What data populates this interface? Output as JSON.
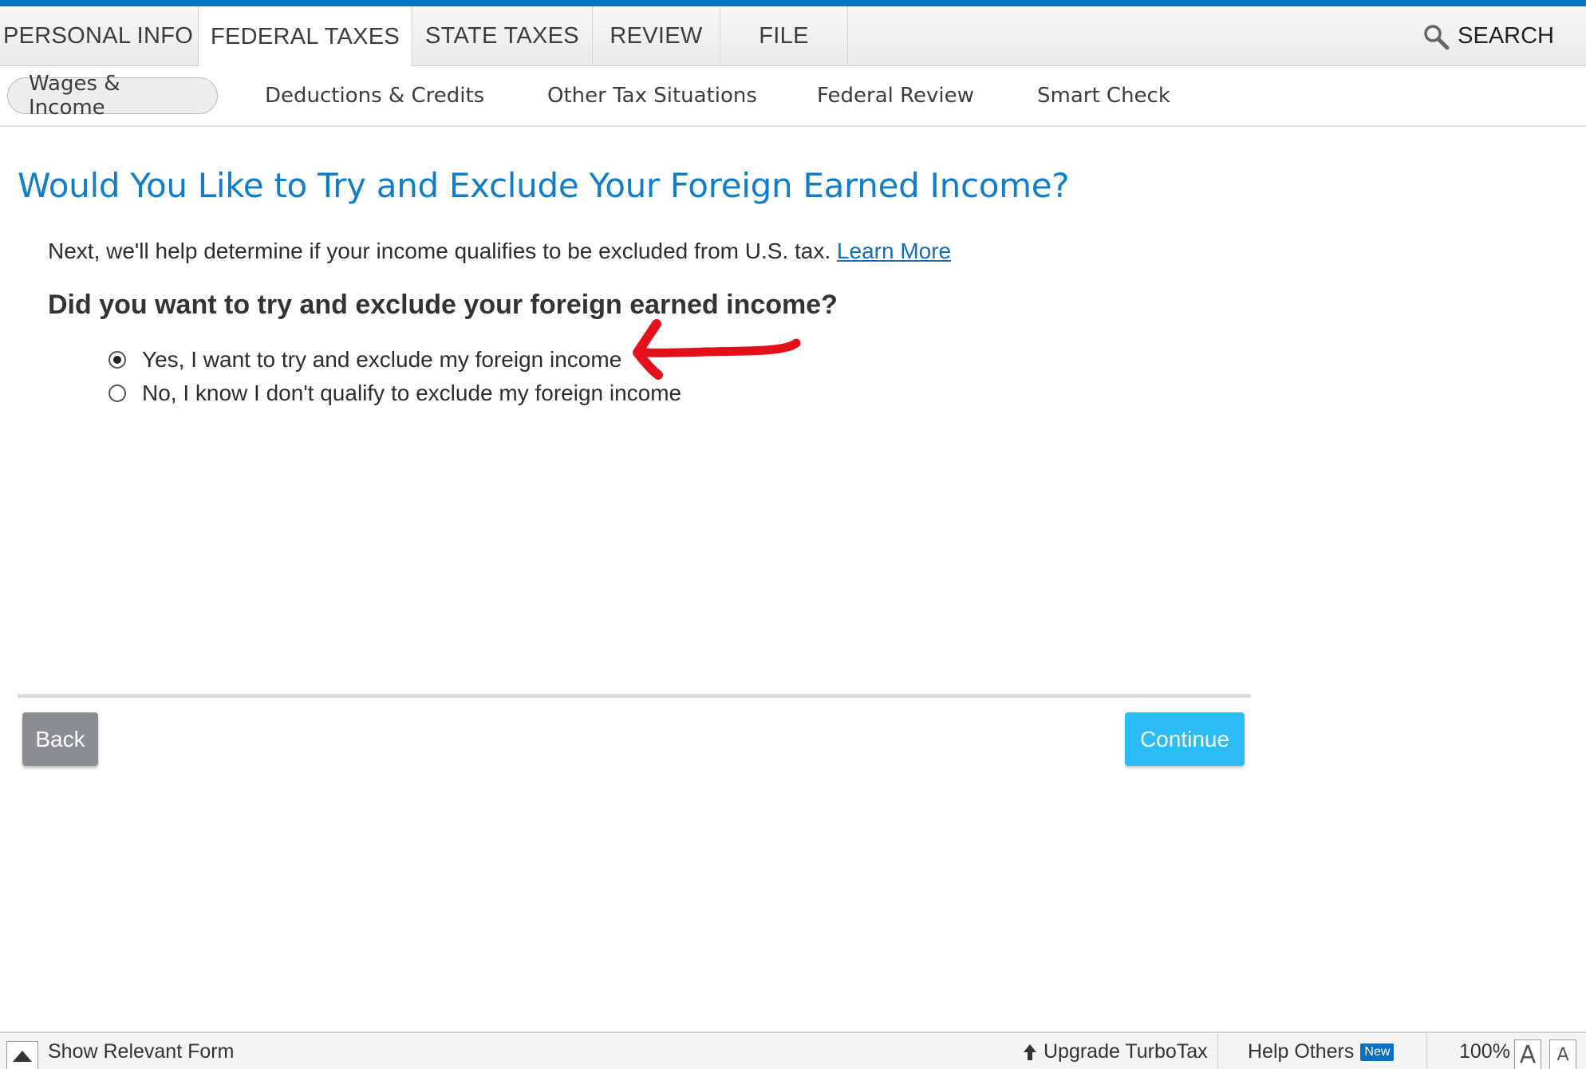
{
  "main_nav": {
    "tabs": [
      {
        "label": "PERSONAL INFO",
        "active": false
      },
      {
        "label": "FEDERAL TAXES",
        "active": true
      },
      {
        "label": "STATE TAXES",
        "active": false
      },
      {
        "label": "REVIEW",
        "active": false
      },
      {
        "label": "FILE",
        "active": false
      }
    ],
    "search_label": "SEARCH"
  },
  "sub_nav": {
    "tabs": [
      {
        "label": "Wages & Income",
        "active": true
      },
      {
        "label": "Deductions & Credits",
        "active": false
      },
      {
        "label": "Other Tax Situations",
        "active": false
      },
      {
        "label": "Federal Review",
        "active": false
      },
      {
        "label": "Smart Check",
        "active": false
      }
    ]
  },
  "page": {
    "title": "Would You Like to Try and Exclude Your Foreign Earned Income?",
    "intro_text": "Next, we'll help determine if your income qualifies to be excluded from U.S. tax.",
    "learn_more": "Learn More",
    "question": "Did you want to try and exclude your foreign earned income?",
    "options": [
      {
        "label": "Yes, I want to try and exclude my foreign income",
        "selected": true
      },
      {
        "label": "No, I know I don't qualify to exclude my foreign income",
        "selected": false
      }
    ]
  },
  "actions": {
    "back_label": "Back",
    "continue_label": "Continue"
  },
  "footer": {
    "show_form_label": "Show Relevant Form",
    "upgrade_label": "Upgrade TurboTax",
    "help_others_label": "Help Others",
    "new_badge": "New",
    "zoom_label": "100%",
    "font_large": "A",
    "font_small": "A"
  },
  "colors": {
    "accent": "#0077c5",
    "title": "#0f7dc8",
    "continue": "#2cbcf5",
    "back": "#8a8d91",
    "annotation": "#e3101c"
  }
}
